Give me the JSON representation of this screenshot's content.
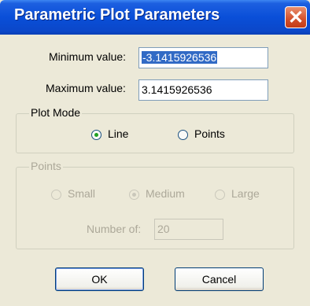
{
  "window": {
    "title": "Parametric Plot Parameters",
    "close_glyph": "✕"
  },
  "range": {
    "min_label": "Minimum value:",
    "min_value": "-3.1415926536",
    "max_label": "Maximum value:",
    "max_value": "3.1415926536"
  },
  "plot_mode": {
    "legend": "Plot Mode",
    "options": [
      {
        "label": "Line",
        "checked": true
      },
      {
        "label": "Points",
        "checked": false
      }
    ]
  },
  "points": {
    "legend": "Points",
    "options": [
      {
        "label": "Small",
        "checked": false
      },
      {
        "label": "Medium",
        "checked": true
      },
      {
        "label": "Large",
        "checked": false
      }
    ],
    "number_label": "Number of:",
    "number_value": "20"
  },
  "buttons": {
    "ok": "OK",
    "cancel": "Cancel"
  }
}
